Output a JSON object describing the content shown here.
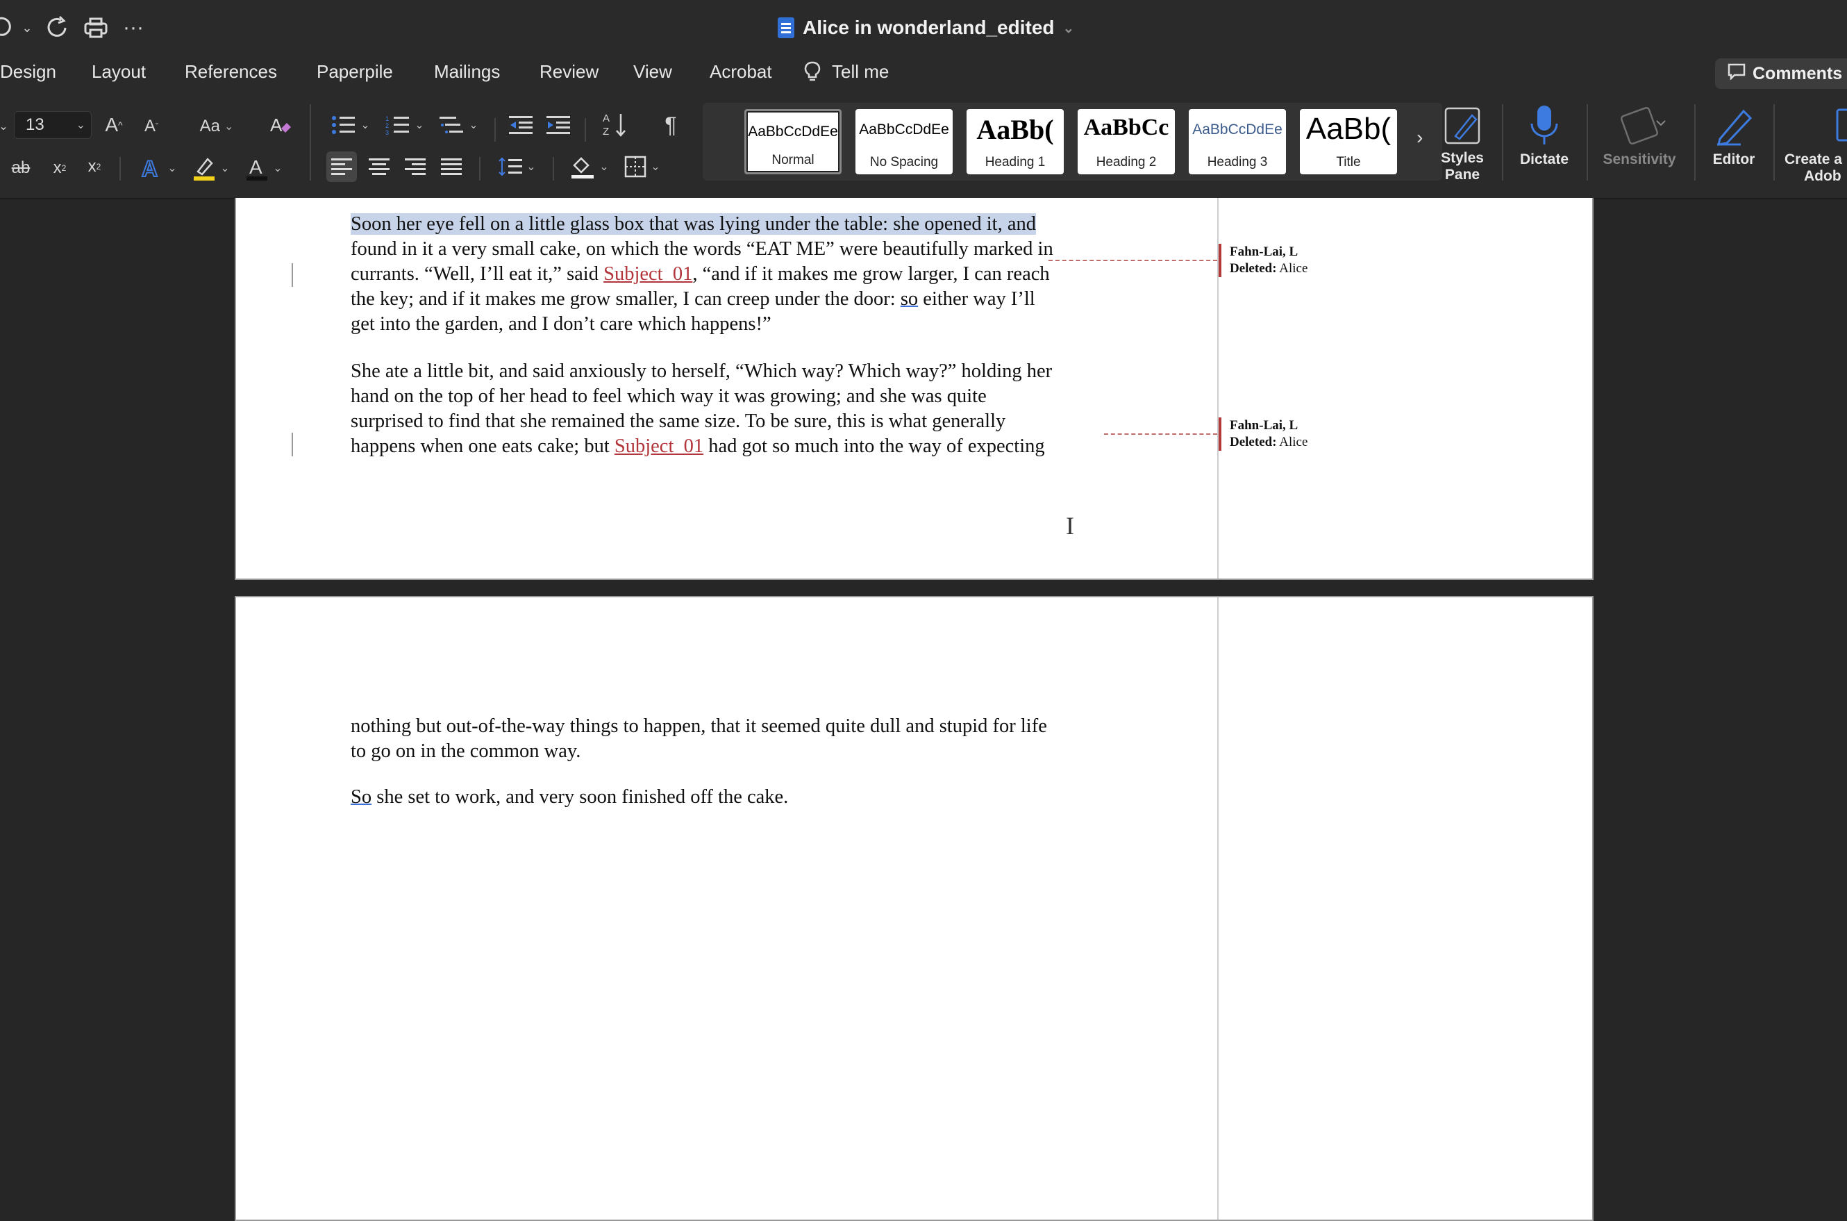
{
  "titlebar": {
    "doc_title": "Alice in wonderland_edited",
    "icons": [
      "undo-icon",
      "chevron-down-icon",
      "redo-icon",
      "print-icon",
      "more-icon"
    ]
  },
  "menu": {
    "tabs": [
      "Design",
      "Layout",
      "References",
      "Paperpile",
      "Mailings",
      "Review",
      "View",
      "Acrobat"
    ],
    "tell_me": "Tell me",
    "comments": "Comments"
  },
  "ribbon": {
    "font_size": "13",
    "styles": [
      {
        "sample": "AaBbCcDdEe",
        "name": "Normal"
      },
      {
        "sample": "AaBbCcDdEe",
        "name": "No Spacing"
      },
      {
        "sample": "AaBb(",
        "name": "Heading 1"
      },
      {
        "sample": "AaBbCc",
        "name": "Heading 2"
      },
      {
        "sample": "AaBbCcDdEe",
        "name": "Heading 3"
      },
      {
        "sample": "AaBb(",
        "name": "Title"
      }
    ],
    "styles_pane_l1": "Styles",
    "styles_pane_l2": "Pane",
    "dictate": "Dictate",
    "sensitivity": "Sensitivity",
    "editor": "Editor",
    "create_l1": "Create a",
    "create_l2": "Adob",
    "accent_blue": "#3d7be0",
    "highlight_yellow": "#f2d21b",
    "font_color_red": "#e02020"
  },
  "document": {
    "p1": {
      "l1": "Soon her eye fell on a little glass box that was lying under the table: she opened it, and",
      "l2": "found in it a very small cake, on which the words “EAT ME” were beautifully marked in",
      "l3a": "currants. “Well, I’ll eat it,” said ",
      "l3ins": "Subject_01",
      "l3b": ", “and if it makes me grow larger, I can reach",
      "l4a": "the key; and if it makes me grow smaller, I can creep under the door: ",
      "l4so": "so",
      "l4b": " either way I’ll",
      "l5": "get into the garden, and I don’t care which happens!”"
    },
    "p2": {
      "l1": "She ate a little bit, and said anxiously to herself, “Which way? Which way?” holding her",
      "l2": "hand on the top of her head to feel which way it was growing; and she was quite",
      "l3": "surprised to find that she remained the same size. To be sure, this is what generally",
      "l4a": "happens when one eats cake; but ",
      "l4ins": "Subject_01",
      "l4b": " had got so much into the way of expecting"
    },
    "p3": {
      "l1": "nothing but out-of-the-way things to happen, that it seemed quite dull and stupid for life",
      "l2": "to go on in the common way."
    },
    "p4": {
      "so": "So",
      "rest": " she set to work, and very soon finished off the cake."
    },
    "balloons": [
      {
        "author": "Fahn-Lai, L",
        "label": "Deleted:",
        "text": " Alice"
      },
      {
        "author": "Fahn-Lai, L",
        "label": "Deleted:",
        "text": " Alice"
      }
    ],
    "tracked_change_color": "#b1353a"
  }
}
